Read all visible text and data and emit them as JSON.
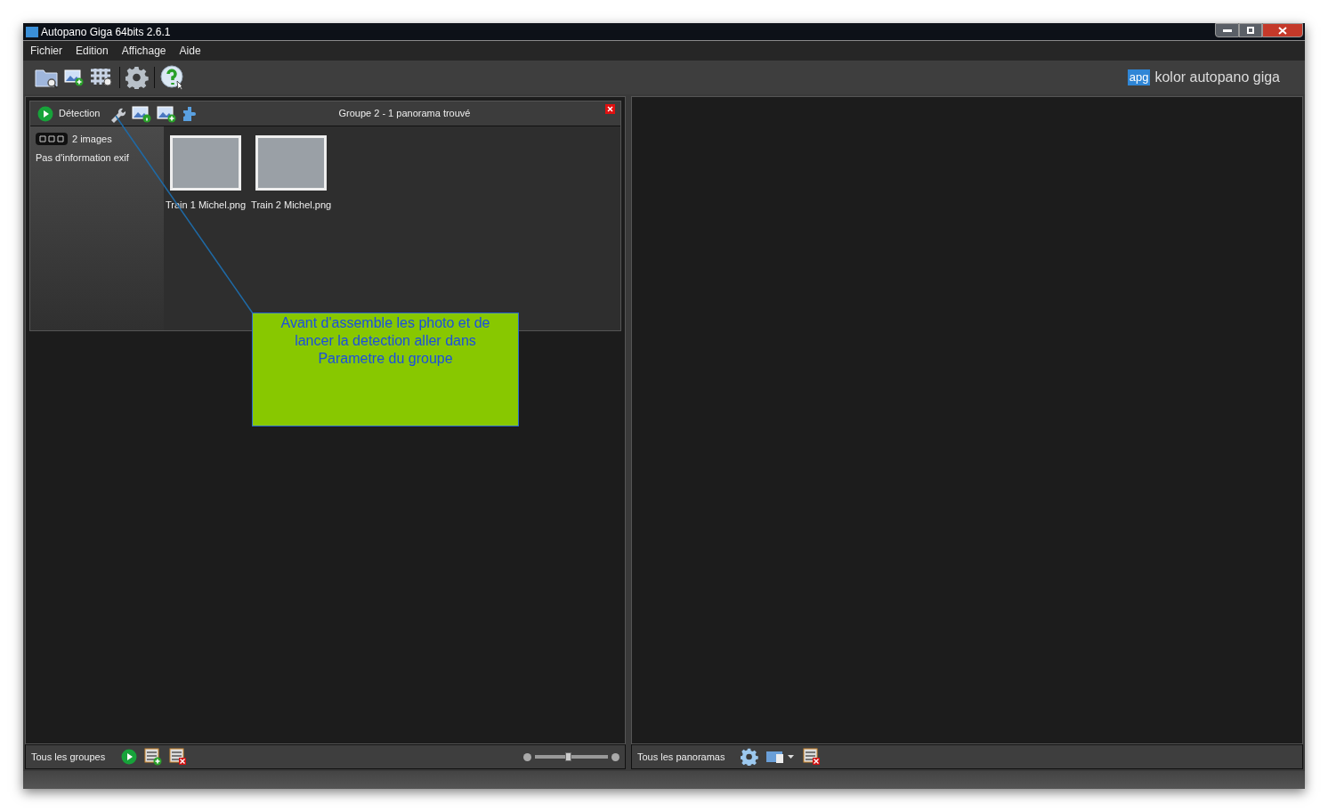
{
  "window": {
    "title": "Autopano Giga 64bits 2.6.1"
  },
  "menu": [
    {
      "label": "Fichier"
    },
    {
      "label": "Edition"
    },
    {
      "label": "Affichage"
    },
    {
      "label": "Aide"
    }
  ],
  "brand": {
    "logo": "apg",
    "name": "kolor autopano giga"
  },
  "group": {
    "detect_label": "Détection",
    "title": "Groupe 2 - 1 panorama trouvé",
    "image_count": "2 images",
    "exif": "Pas d'information exif",
    "images": [
      {
        "name": "Train 1 Michel.png"
      },
      {
        "name": "Train 2 Michel.png"
      }
    ]
  },
  "note": {
    "text": "Avant d'assemble les photo et de lancer la detection aller dans Parametre du groupe"
  },
  "left_footer": {
    "label": "Tous les groupes",
    "zoom": {
      "level": 0.45
    }
  },
  "right_footer": {
    "label": "Tous les panoramas"
  }
}
